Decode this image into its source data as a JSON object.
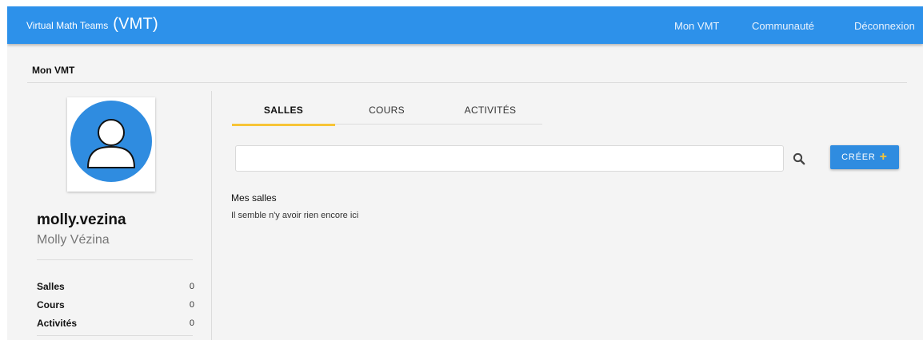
{
  "header": {
    "brand_name": "Virtual Math Teams",
    "brand_abbr": "(VMT)",
    "nav": [
      "Mon VMT",
      "Communauté",
      "Déconnexion"
    ],
    "color": "#2d91ea"
  },
  "breadcrumb": {
    "label": "Mon VMT"
  },
  "profile": {
    "avatar_icon": "user-avatar-icon",
    "username": "molly.vezina",
    "full_name": "Molly Vézina",
    "stats": [
      {
        "label": "Salles",
        "value": "0"
      },
      {
        "label": "Cours",
        "value": "0"
      },
      {
        "label": "Activités",
        "value": "0"
      }
    ]
  },
  "tabs": [
    {
      "label": "SALLES",
      "active": true
    },
    {
      "label": "COURS",
      "active": false
    },
    {
      "label": "ACTIVITÉS",
      "active": false
    }
  ],
  "search": {
    "value": "",
    "placeholder": "",
    "icon": "search-icon"
  },
  "create_button": {
    "label": "CRÉER",
    "icon": "plus-icon",
    "plus": "+"
  },
  "content": {
    "section_title": "Mes salles",
    "empty_message": "Il semble n'y avoir rien encore ici"
  },
  "colors": {
    "accent": "#f7c436",
    "primary": "#2f8ce0"
  }
}
